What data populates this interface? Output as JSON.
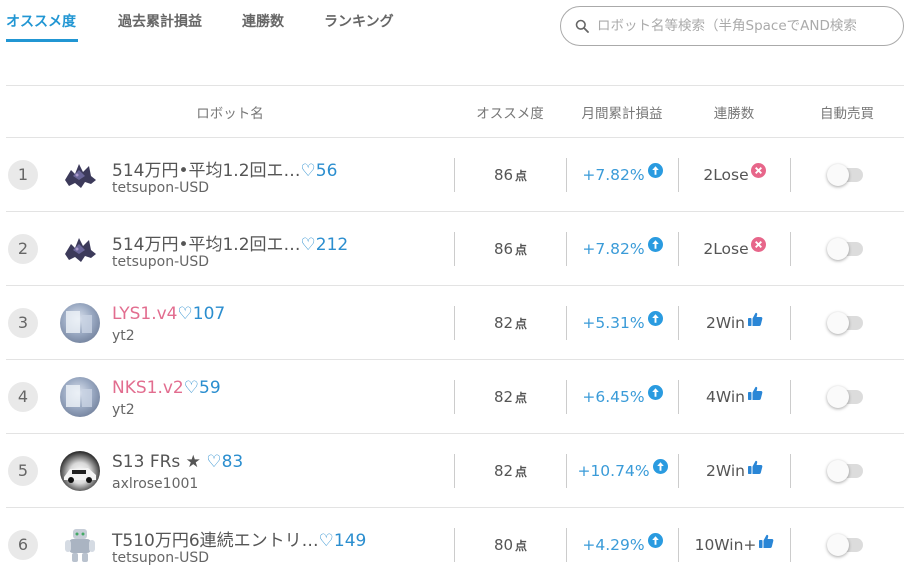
{
  "tabs": [
    {
      "label": "オススメ度",
      "active": true
    },
    {
      "label": "過去累計損益",
      "active": false
    },
    {
      "label": "連勝数",
      "active": false
    },
    {
      "label": "ランキング",
      "active": false
    }
  ],
  "search": {
    "placeholder": "ロボット名等検索（半角SpaceでAND検索"
  },
  "columns": {
    "name": "ロボット名",
    "score": "オススメ度",
    "profit": "月間累計損益",
    "streak": "連勝数",
    "auto": "自動売買"
  },
  "score_unit": "点",
  "heart": "♡",
  "accent_color": "#2196d3",
  "profit_color": "#3a9bd8",
  "pink_name_color": "#e26d8f",
  "rows": [
    {
      "rank": "1",
      "avatar": "monster-icon",
      "name": "514万円•平均1.2回エ…",
      "likes": "56",
      "owner": "tetsupon-USD",
      "score": "86",
      "profit": "+7.82%",
      "streak": "2Lose",
      "streak_icon": "lose-icon",
      "auto_on": false
    },
    {
      "rank": "2",
      "avatar": "monster-icon",
      "name": "514万円•平均1.2回エ…",
      "likes": "212",
      "owner": "tetsupon-USD",
      "score": "86",
      "profit": "+7.82%",
      "streak": "2Lose",
      "streak_icon": "lose-icon",
      "auto_on": false
    },
    {
      "rank": "3",
      "avatar": "photo-avatar",
      "name": "LYS1.v4",
      "likes": "107",
      "owner": "yt2",
      "score": "82",
      "profit": "+5.31%",
      "streak": "2Win",
      "streak_icon": "thumbs-up-icon",
      "auto_on": false
    },
    {
      "rank": "4",
      "avatar": "photo-avatar",
      "name": "NKS1.v2",
      "likes": "59",
      "owner": "yt2",
      "score": "82",
      "profit": "+6.45%",
      "streak": "4Win",
      "streak_icon": "thumbs-up-icon",
      "auto_on": false
    },
    {
      "rank": "5",
      "avatar": "car-avatar",
      "name": "S13 FRs ★ ",
      "likes": "83",
      "owner": "axlrose1001",
      "score": "82",
      "profit": "+10.74%",
      "streak": "2Win",
      "streak_icon": "thumbs-up-icon",
      "auto_on": false
    },
    {
      "rank": "6",
      "avatar": "robot-icon",
      "name": "T510万円6連続エントリ…",
      "likes": "149",
      "owner": "tetsupon-USD",
      "score": "80",
      "profit": "+4.29%",
      "streak": "10Win+",
      "streak_icon": "thumbs-up-icon",
      "auto_on": false
    }
  ]
}
